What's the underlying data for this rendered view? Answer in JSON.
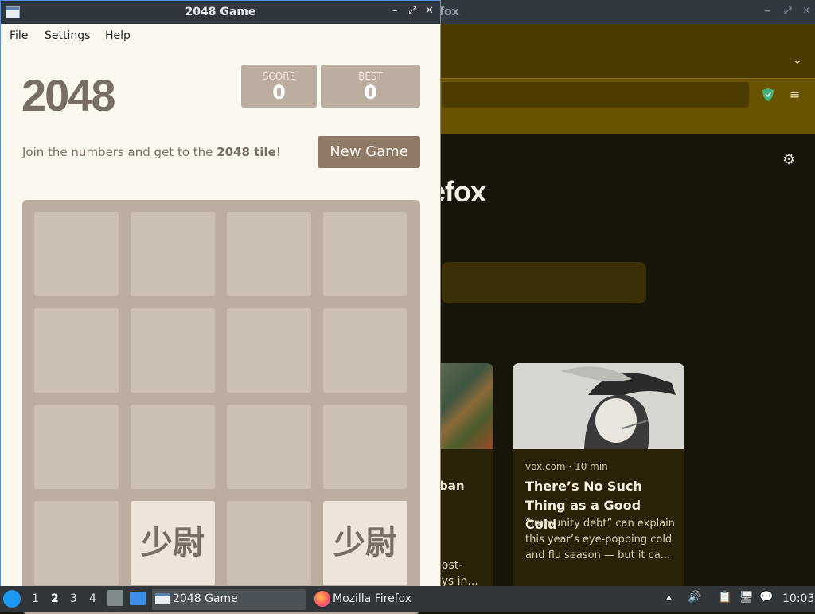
{
  "firefox": {
    "window_title": "Mozilla Firefox",
    "logo_partial": "efox",
    "cards": [
      {
        "title_partial": "ban",
        "desc_partial": "v\nnost-\nays in..."
      },
      {
        "source": "vox.com · 10 min",
        "title": "There’s No Such Thing as a Good Cold",
        "description": "“Immunity debt” can explain this year’s eye-popping cold and flu season — but it ca..."
      }
    ]
  },
  "game": {
    "window_title": "2048 Game",
    "menu": [
      "File",
      "Settings",
      "Help"
    ],
    "heading": "2048",
    "score": {
      "label": "SCORE",
      "value": "0"
    },
    "best": {
      "label": "BEST",
      "value": "0"
    },
    "intro_prefix": "Join the numbers and get to the ",
    "intro_bold": "2048 tile",
    "intro_suffix": "!",
    "new_game_label": "New Game",
    "grid_rows": 4,
    "grid_cols": 4,
    "tiles": [
      {
        "row": 3,
        "col": 1,
        "text": "少尉"
      },
      {
        "row": 3,
        "col": 3,
        "text": "少尉"
      }
    ]
  },
  "taskbar": {
    "workspaces": [
      "1",
      "2",
      "3",
      "4"
    ],
    "active_workspace": "2",
    "tasks": [
      "2048 Game",
      "Mozilla Firefox"
    ],
    "clock": "10:03"
  },
  "colors": {
    "game_bg": "#fbf8ef",
    "board": "#bbada0",
    "tile": "#eee4da",
    "text": "#776e65",
    "new_game_button": "#8f7a66",
    "firefox_accent": "#6a5300",
    "taskbar": "#31363b"
  },
  "icons": [
    "app-window-icon",
    "minimize-icon",
    "maximize-icon",
    "close-icon",
    "shield-icon",
    "hamburger-menu-icon",
    "gear-icon",
    "start-menu-icon",
    "file-manager-icon",
    "show-desktop-icon",
    "firefox-icon",
    "volume-icon",
    "clipboard-icon",
    "network-icon",
    "notification-icon"
  ]
}
